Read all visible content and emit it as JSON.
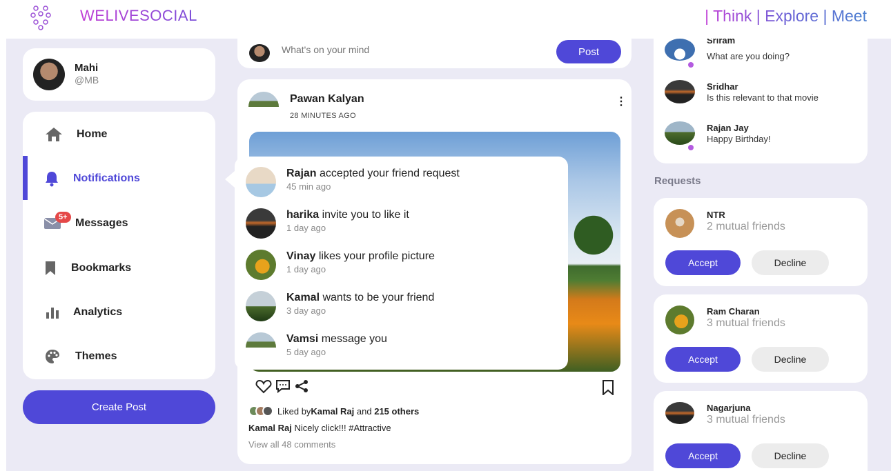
{
  "header": {
    "logo_text": "WELIVESOCIAL",
    "tagline": "| Think | Explore | Meet"
  },
  "profile": {
    "name": "Mahi",
    "handle": "@MB"
  },
  "nav": {
    "items": [
      {
        "label": "Home",
        "icon": "home-icon"
      },
      {
        "label": "Notifications",
        "icon": "bell-icon",
        "active": true
      },
      {
        "label": "Messages",
        "icon": "mail-icon",
        "badge": "5+"
      },
      {
        "label": "Bookmarks",
        "icon": "bookmark-icon"
      },
      {
        "label": "Analytics",
        "icon": "bar-chart-icon"
      },
      {
        "label": "Themes",
        "icon": "palette-icon"
      }
    ],
    "create_post": "Create Post"
  },
  "compose": {
    "placeholder": "What's on your mind",
    "post_label": "Post"
  },
  "post": {
    "author": "Pawan Kalyan",
    "time": "28 MINUTES AGO",
    "liked_prefix": "Liked by ",
    "liked_user": "Kamal Raj",
    "liked_mid": " and ",
    "liked_count": "215 others",
    "caption_user": "Kamal Raj",
    "caption_text": " Nicely click!!! #Attractive",
    "view_comments": "View all 48 comments"
  },
  "notifications": [
    {
      "name": "Rajan",
      "text": " accepted your friend request",
      "time": "45 min ago"
    },
    {
      "name": "harika",
      "text": " invite you to like it",
      "time": "1 day ago"
    },
    {
      "name": "Vinay",
      "text": " likes your profile picture",
      "time": "1 day ago"
    },
    {
      "name": "Kamal",
      "text": " wants to be your friend",
      "time": "3 day ago"
    },
    {
      "name": "Vamsi",
      "text": " message you",
      "time": "5 day ago"
    }
  ],
  "messages": [
    {
      "name": "Sriram",
      "text": "What are you doing?"
    },
    {
      "name": "Sridhar",
      "text": "Is this relevant to that movie"
    },
    {
      "name": "Rajan Jay",
      "text": "Happy Birthday!"
    }
  ],
  "requests": {
    "title": "Requests",
    "accept_label": "Accept",
    "decline_label": "Decline",
    "items": [
      {
        "name": "NTR",
        "mutual": "2 mutual friends"
      },
      {
        "name": "Ram Charan",
        "mutual": "3 mutual friends"
      },
      {
        "name": "Nagarjuna",
        "mutual": "3 mutual friends"
      }
    ]
  },
  "colors": {
    "accent": "#4f48d8",
    "background": "#ebeaf5",
    "badge": "#e54848",
    "online": "#b45be0"
  }
}
